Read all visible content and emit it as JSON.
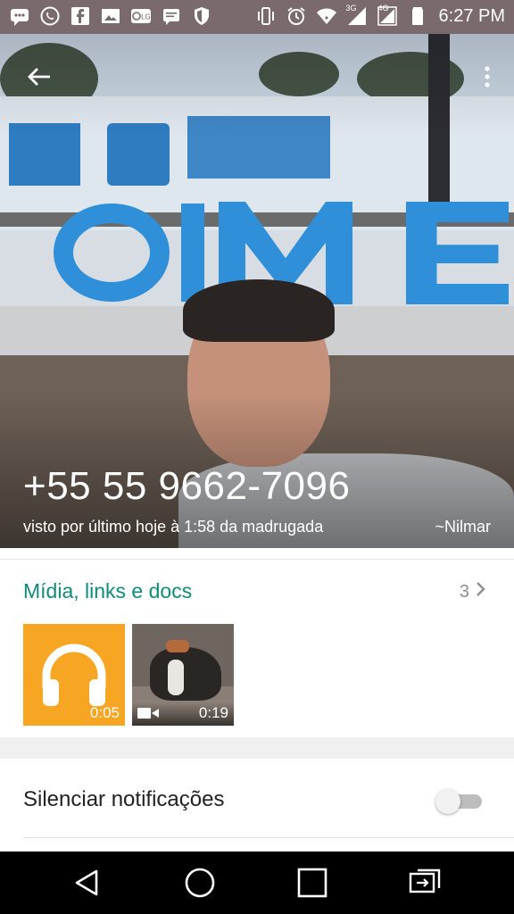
{
  "status_bar": {
    "time": "6:27 PM",
    "network_label_1": "3G",
    "network_label_2": "4G",
    "left_icons": [
      "message-icon",
      "whatsapp-icon",
      "facebook-icon",
      "image-icon",
      "lg-icon",
      "chat-icon",
      "shield-icon"
    ],
    "right_icons": [
      "vibrate-icon",
      "alarm-icon",
      "wifi-icon",
      "signal-icon",
      "signal-icon",
      "battery-icon"
    ]
  },
  "profile": {
    "phone": "+55 55 9662-7096",
    "last_seen": "visto por último hoje à 1:58 da madrugada",
    "nickname": "~Nilmar"
  },
  "media": {
    "title": "Mídia, links e docs",
    "count": "3",
    "items": [
      {
        "type": "audio",
        "duration": "0:05",
        "color": "#f6a623"
      },
      {
        "type": "video",
        "duration": "0:19"
      }
    ]
  },
  "settings": {
    "mute_label": "Silenciar notificações",
    "mute_enabled": false
  },
  "colors": {
    "accent": "#0f8c79",
    "status_bar": "#7a6a6e"
  }
}
